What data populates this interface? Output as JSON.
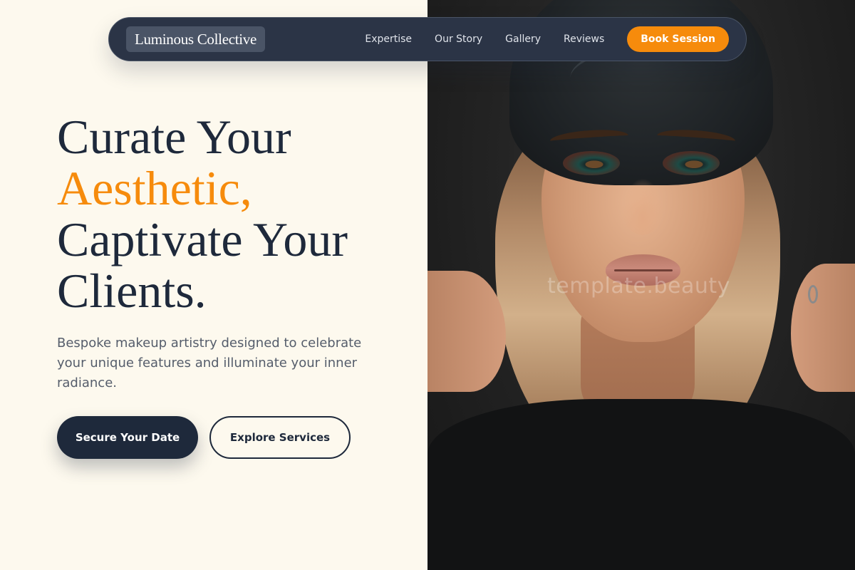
{
  "nav": {
    "brand": "Luminous Collective",
    "links": [
      {
        "label": "Expertise"
      },
      {
        "label": "Our Story"
      },
      {
        "label": "Gallery"
      },
      {
        "label": "Reviews"
      }
    ],
    "cta": "Book Session"
  },
  "hero": {
    "title_line1": "Curate Your",
    "title_accent": "Aesthetic,",
    "title_line3": "Captivate Your",
    "title_line4": "Clients.",
    "subtitle": "Bespoke makeup artistry designed to celebrate your unique features and illuminate your inner radiance.",
    "primary_button": "Secure Your Date",
    "secondary_button": "Explore Services"
  },
  "photo": {
    "watermark": "template.beauty"
  },
  "colors": {
    "accent": "#f68b0c",
    "navy": "#1e293b",
    "nav_bg": "#2b3446",
    "page_bg": "#fdf9ee"
  }
}
